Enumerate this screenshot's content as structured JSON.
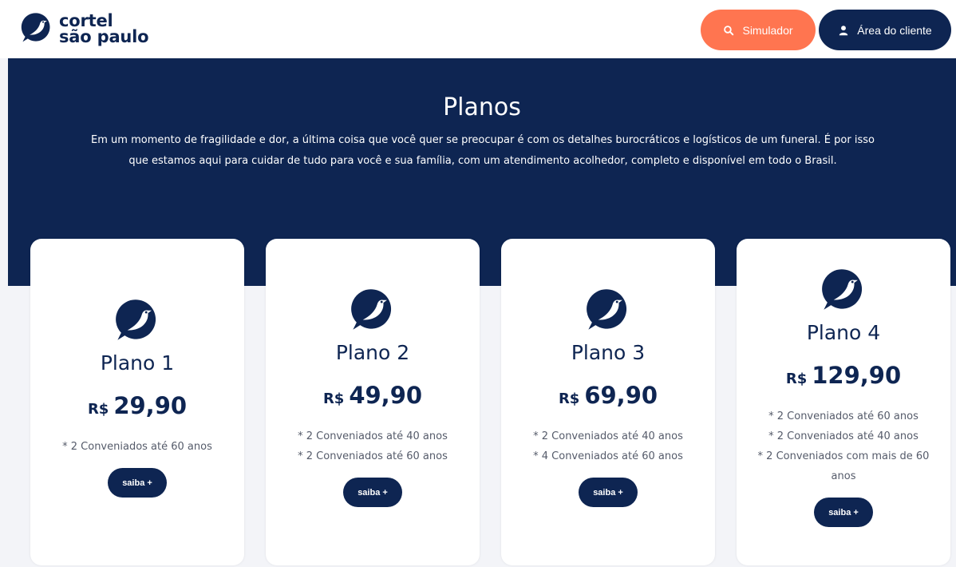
{
  "header": {
    "logo_line1": "cortel",
    "logo_line2": "são paulo",
    "simulator_label": "Simulador",
    "client_area_label": "Área do cliente"
  },
  "hero": {
    "title": "Planos",
    "description": "Em um momento de fragilidade e dor, a última coisa que você quer se preocupar é com os detalhes burocráticos e logísticos de um funeral. É por isso que estamos aqui para cuidar de tudo para você e sua família, com um atendimento acolhedor, completo e disponível em todo o Brasil."
  },
  "plans": [
    {
      "name": "Plano 1",
      "currency": "R$",
      "price": "29,90",
      "features": [
        "* 2 Conveniados até 60 anos"
      ],
      "cta": "saiba +"
    },
    {
      "name": "Plano 2",
      "currency": "R$",
      "price": "49,90",
      "features": [
        "* 2 Conveniados até 40 anos",
        "* 2 Conveniados até 60 anos"
      ],
      "cta": "saiba +"
    },
    {
      "name": "Plano 3",
      "currency": "R$",
      "price": "69,90",
      "features": [
        "* 2 Conveniados até 40 anos",
        "* 4 Conveniados até 60 anos"
      ],
      "cta": "saiba +"
    },
    {
      "name": "Plano 4",
      "currency": "R$",
      "price": "129,90",
      "features": [
        "* 2 Conveniados até 60 anos",
        "* 2 Conveniados até 40 anos",
        "* 2 Conveniados com mais de 60 anos"
      ],
      "cta": "saiba +"
    }
  ],
  "colors": {
    "navy": "#0e2552",
    "accent": "#ff7550",
    "background": "#f3f4f8"
  },
  "icons": {
    "logo": "bird-icon",
    "simulator": "search-icon",
    "client": "user-icon",
    "plan": "bird-icon"
  }
}
